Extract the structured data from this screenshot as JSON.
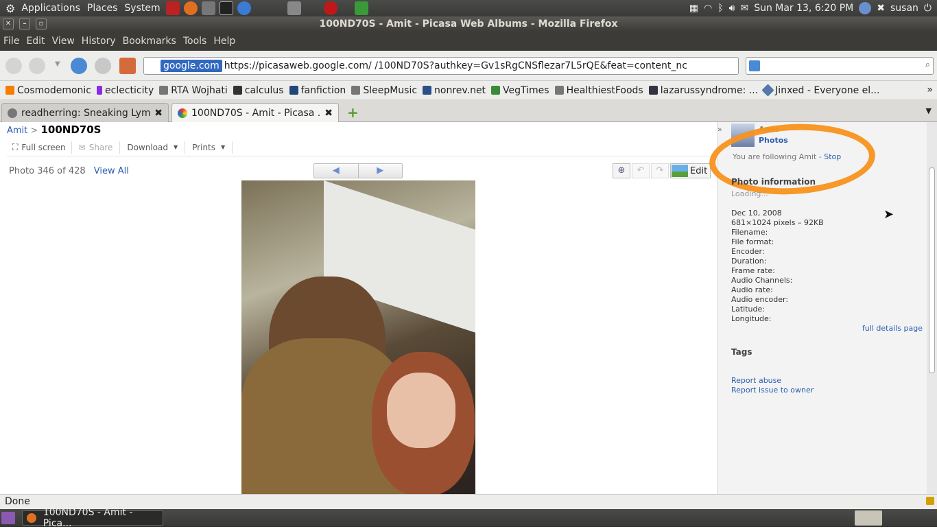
{
  "panel": {
    "menus": [
      "Applications",
      "Places",
      "System"
    ],
    "datetime": "Sun Mar 13,  6:20 PM",
    "user": "susan"
  },
  "window": {
    "title": "100ND70S - Amit - Picasa Web Albums - Mozilla Firefox"
  },
  "menubar": [
    "File",
    "Edit",
    "View",
    "History",
    "Bookmarks",
    "Tools",
    "Help"
  ],
  "nav": {
    "site": "google.com",
    "url": "https://picasaweb.google.com/            /100ND70S?authkey=Gv1sRgCNSflezar7L5rQE&feat=content_nc"
  },
  "bookmarks": [
    "Cosmodemonic",
    "eclecticity",
    "RTA Wojhati",
    "calculus",
    "fanfiction",
    "SleepMusic",
    "nonrev.net",
    "VegTimes",
    "HealthiestFoods",
    "lazarussyndrome: ...",
    "Jinxed - Everyone el..."
  ],
  "tabs": [
    {
      "label": "readherring: Sneaking Lym..."
    },
    {
      "label": "100ND70S - Amit - Picasa ..."
    }
  ],
  "breadcrumb": {
    "owner": "Amit",
    "sep": ">",
    "album": "100ND70S"
  },
  "toolbar": {
    "fullscreen": "Full screen",
    "share": "Share",
    "download": "Download",
    "prints": "Prints",
    "edit": "Edit"
  },
  "photo": {
    "counter": "Photo 346 of 428",
    "view_all": "View All"
  },
  "sidebar": {
    "owner": "Amit",
    "photos_link": "Photos",
    "following": "You are following Amit - ",
    "stop": "Stop",
    "info_title": "Photo information",
    "loading": "Loading...",
    "date": "Dec 10, 2008",
    "dims": "681×1024 pixels – 92KB",
    "fields": [
      "Filename:",
      "File format:",
      "Encoder:",
      "Duration:",
      "Frame rate:",
      "Audio Channels:",
      "Audio rate:",
      "Audio encoder:",
      "Latitude:",
      "Longitude:"
    ],
    "full_details": "full details page",
    "tags": "Tags",
    "report_abuse": "Report abuse",
    "report_issue": "Report issue to owner"
  },
  "status": "Done",
  "taskbar": {
    "window": "100ND70S - Amit - Pica..."
  },
  "colors": {
    "highlight": "#f7921e",
    "link": "#2a5db0"
  }
}
